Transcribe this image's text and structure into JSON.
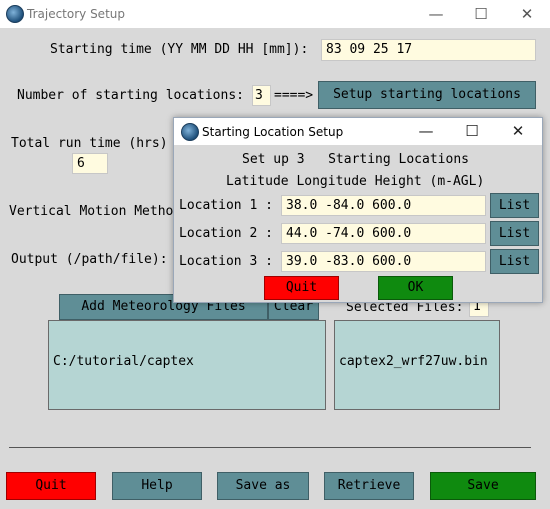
{
  "window": {
    "title": "Trajectory Setup",
    "minimize": "—",
    "maximize": "☐",
    "close": "✕"
  },
  "main": {
    "starting_time_label": "Starting time (YY MM DD HH [mm]):",
    "starting_time_value": "83 09 25 17",
    "num_locations_label": "Number of starting locations:",
    "num_locations_value": "3",
    "arrow_text": "====>",
    "setup_locations_button": "Setup starting locations",
    "total_run_time_label": "Total run time (hrs)",
    "total_run_time_value": "6",
    "vertical_motion_label": "Vertical Motion Metho",
    "output_label": "Output (/path/file):",
    "add_met_button": "Add Meteorology Files",
    "clear_button": "Clear",
    "selected_files_label": "Selected Files:",
    "selected_files_value": "1",
    "met_dir_list": [
      "C:/tutorial/captex"
    ],
    "met_file_list": [
      "captex2_wrf27uw.bin"
    ]
  },
  "buttons": {
    "quit": "Quit",
    "help": "Help",
    "save_as": "Save as",
    "retrieve": "Retrieve",
    "save": "Save"
  },
  "dialog": {
    "title": "Starting Location Setup",
    "minimize": "—",
    "maximize": "☐",
    "close": "✕",
    "header": "Set up 3   Starting Locations",
    "subheader": "Latitude Longitude Height (m-AGL)",
    "locations": [
      {
        "label": "Location 1 :",
        "value": "38.0 -84.0 600.0",
        "list": "List"
      },
      {
        "label": "Location 2 :",
        "value": "44.0 -74.0 600.0",
        "list": "List"
      },
      {
        "label": "Location 3 :",
        "value": "39.0 -83.0 600.0",
        "list": "List"
      }
    ],
    "quit_button": "Quit",
    "ok_button": "OK"
  },
  "colors": {
    "quit_red": "#ff0000",
    "save_green": "#0f8a0f",
    "teal_button": "#5f8e96",
    "entry_bg": "#fffbe0",
    "list_bg": "#b5d5d3"
  }
}
